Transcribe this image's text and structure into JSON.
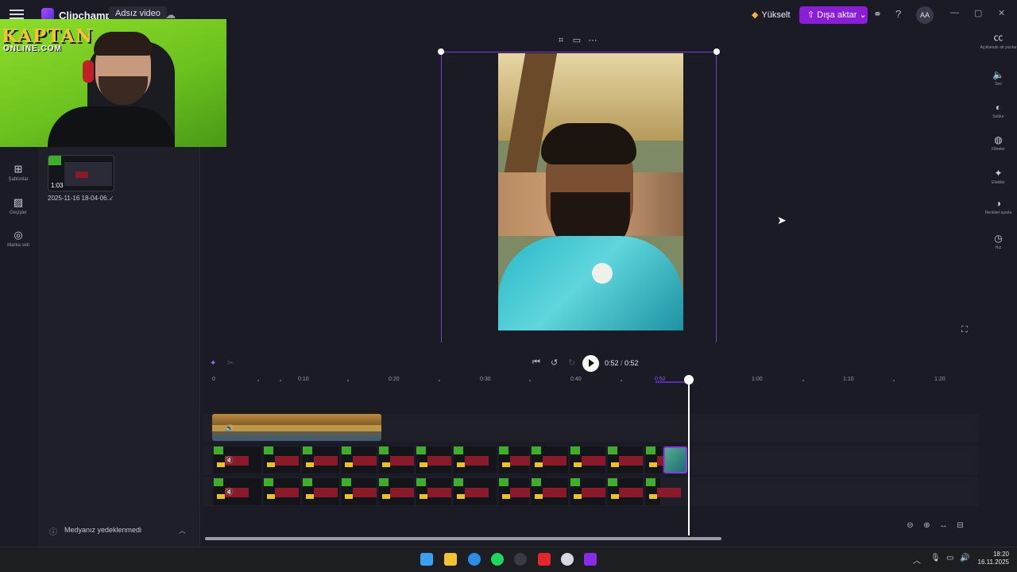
{
  "app": {
    "name": "Clipchamp",
    "project_title": "Adsız video"
  },
  "header": {
    "upgrade_label": "Yükselt",
    "export_label": "Dışa aktar",
    "avatar_initials": "AA",
    "accent_color": "#8a1ed8"
  },
  "webcam": {
    "brand_top": "KAPTAN",
    "brand_bottom": "ONLINE.COM"
  },
  "left_rail": {
    "items": [
      {
        "label": "Şablonlar",
        "icon": "templates-icon"
      },
      {
        "label": "Geçişler",
        "icon": "transitions-icon"
      },
      {
        "label": "Marka seti",
        "icon": "brand-kit-icon"
      }
    ]
  },
  "media": {
    "items": [
      {
        "duration": "1:03",
        "name": "2025-11-16 18-04-06..."
      }
    ],
    "backup_status": "Medyanız yedeklenmedi"
  },
  "right_rail": {
    "items": [
      {
        "label": "Açıklamalı alt yazılar",
        "icon": "captions-icon"
      },
      {
        "label": "Ses",
        "icon": "audio-icon"
      },
      {
        "label": "Soldur",
        "icon": "fade-icon"
      },
      {
        "label": "Filtreler",
        "icon": "filters-icon"
      },
      {
        "label": "Efektler",
        "icon": "effects-icon"
      },
      {
        "label": "Renkleri ayarla",
        "icon": "adjust-colors-icon"
      },
      {
        "label": "Hız",
        "icon": "speed-icon"
      }
    ]
  },
  "playback": {
    "current_time": "0:52",
    "total_time": "0:52"
  },
  "timeline": {
    "ruler": [
      "0",
      "0:10",
      "0:20",
      "0:30",
      "0:40",
      "0:50",
      "1:00",
      "1:10",
      "1:20"
    ],
    "playhead_label": "0:52"
  },
  "taskbar": {
    "time": "18:20",
    "date": "16.11.2025"
  }
}
